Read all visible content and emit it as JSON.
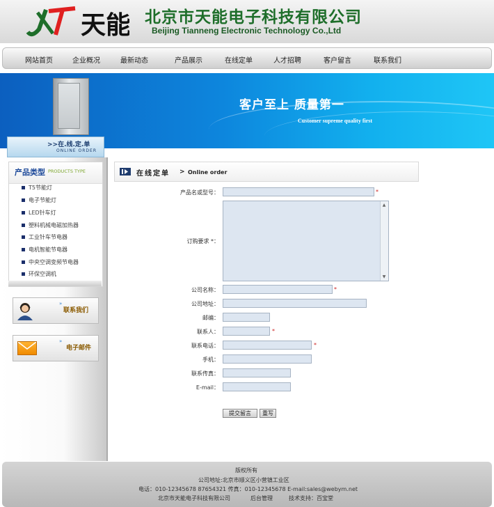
{
  "header": {
    "company_cn": "北京市天能电子科技有限公司",
    "company_en": "Beijing Tianneng Electronic Technology Co.,Ltd"
  },
  "nav": [
    "网站首页",
    "企业概况",
    "最新动态",
    "产品展示",
    "在线定单",
    "人才招聘",
    "客户留言",
    "联系我们"
  ],
  "banner": {
    "slogan": "客户至上   质量第一",
    "slogan_en": "Customer supreme quality first"
  },
  "section_tab": {
    "title": ">>在.线.定.单",
    "subtitle": "ONLINE ORDER"
  },
  "sidebar": {
    "category_title": "产品类型",
    "category_sub": "PRODUCTS TYPE",
    "categories": [
      "T5节能灯",
      "电子节能灯",
      "LED针车灯",
      "塑料机械电磁加热器",
      "工业针车节电器",
      "电机智能节电器",
      "中央空调变频节电器",
      "环保空调机"
    ],
    "contact_label": "联系我们",
    "email_label": "电子邮件"
  },
  "main": {
    "title": "在线定单",
    "sep": ">",
    "title_en": "Online order"
  },
  "form": {
    "product_label": "产品名或型号：",
    "requirement_label": "订购要求 *：",
    "company_label": "公司名称：",
    "address_label": "公司地址：",
    "postcode_label": "邮编：",
    "contact_label": "联系人：",
    "phone_label": "联系电话：",
    "mobile_label": "手机：",
    "fax_label": "联系传真：",
    "email_label": "E-mail：",
    "required_mark": "*",
    "submit_label": "提交留言",
    "reset_label": "重写"
  },
  "footer": {
    "copyright": "版权所有",
    "address": "公司地址:北京市顺义区小营镇工业区",
    "contact": "电话：010-12345678 87654321 传真：010-12345678 E-mail:sales@webym.net",
    "company": "北京市天能电子科技有限公司",
    "admin": "后台管理",
    "support": "技术支持：百宝堂"
  },
  "colors": {
    "brand_green": "#1e6e2a",
    "logo_red": "#e02020",
    "banner_blue": "#0d86dd",
    "input_bg": "#dde6f1"
  }
}
